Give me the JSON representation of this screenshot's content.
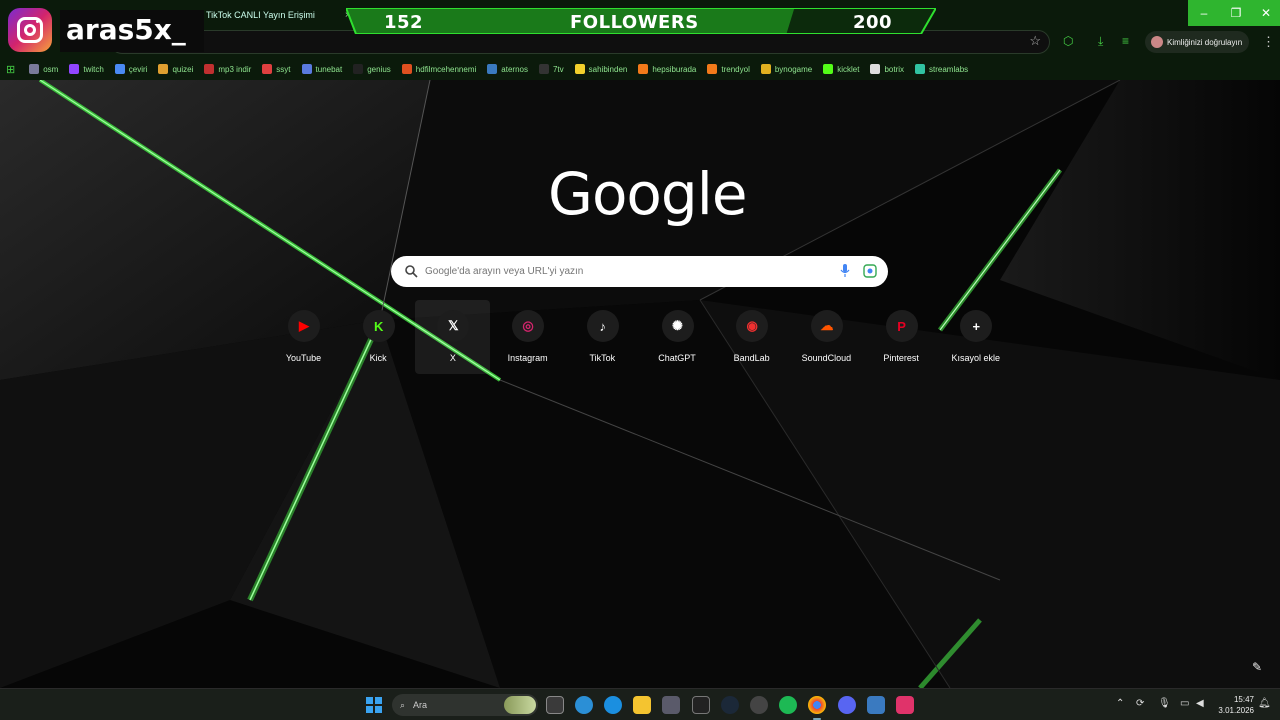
{
  "tabs": [
    {
      "title": "TikTok CANLI Yayın Erişimi",
      "close": "×"
    }
  ],
  "window_controls": {
    "minimize": "–",
    "maximize": "❐",
    "close": "✕"
  },
  "overlay": {
    "followers_current": "152",
    "followers_label": "FOLLOWERS",
    "followers_goal": "200",
    "progress_fraction": 0.76,
    "instagram_handle": "aras5x_"
  },
  "toolbar": {
    "profile_label": "Kimliğinizi doğrulayın",
    "star_icon": "star-icon"
  },
  "bookmarks": [
    {
      "label": "osm",
      "color": "#7a7a9a"
    },
    {
      "label": "twitch",
      "color": "#9146ff"
    },
    {
      "label": "çeviri",
      "color": "#4a8af4"
    },
    {
      "label": "quizei",
      "color": "#e0a030"
    },
    {
      "label": "mp3 indir",
      "color": "#c03030"
    },
    {
      "label": "ssyt",
      "color": "#e04040"
    },
    {
      "label": "tunebat",
      "color": "#5a7ae0"
    },
    {
      "label": "genius",
      "color": "#222222"
    },
    {
      "label": "hdfilmcehennemi",
      "color": "#e05020"
    },
    {
      "label": "aternos",
      "color": "#3a7ac0"
    },
    {
      "label": "7tv",
      "color": "#333333"
    },
    {
      "label": "sahibinden",
      "color": "#f2d02c"
    },
    {
      "label": "hepsiburada",
      "color": "#f27a1a"
    },
    {
      "label": "trendyol",
      "color": "#f27a1a"
    },
    {
      "label": "bynogame",
      "color": "#e0b020"
    },
    {
      "label": "kicklet",
      "color": "#53fc18"
    },
    {
      "label": "botrix",
      "color": "#dddddd"
    },
    {
      "label": "streamlabs",
      "color": "#31c3a2"
    }
  ],
  "google": {
    "logo_text": "Google",
    "search_placeholder": "Google'da arayın veya URL'yi yazın"
  },
  "shortcuts": [
    {
      "label": "YouTube",
      "icon": "youtube-icon",
      "color": "#ff0000"
    },
    {
      "label": "Kick",
      "icon": "kick-icon",
      "color": "#53fc18"
    },
    {
      "label": "X",
      "icon": "x-icon",
      "color": "#ffffff"
    },
    {
      "label": "Instagram",
      "icon": "instagram-icon",
      "color": "#d3246c"
    },
    {
      "label": "TikTok",
      "icon": "tiktok-icon",
      "color": "#ffffff"
    },
    {
      "label": "ChatGPT",
      "icon": "chatgpt-icon",
      "color": "#ffffff"
    },
    {
      "label": "BandLab",
      "icon": "bandlab-icon",
      "color": "#f03030"
    },
    {
      "label": "SoundCloud",
      "icon": "soundcloud-icon",
      "color": "#ff5500"
    },
    {
      "label": "Pinterest",
      "icon": "pinterest-icon",
      "color": "#e60023"
    },
    {
      "label": "Kısayol ekle",
      "icon": "plus-icon",
      "color": "#ffffff"
    }
  ],
  "taskbar": {
    "search_label": "Ara",
    "time": "15:47",
    "date": "3.01.2026"
  }
}
